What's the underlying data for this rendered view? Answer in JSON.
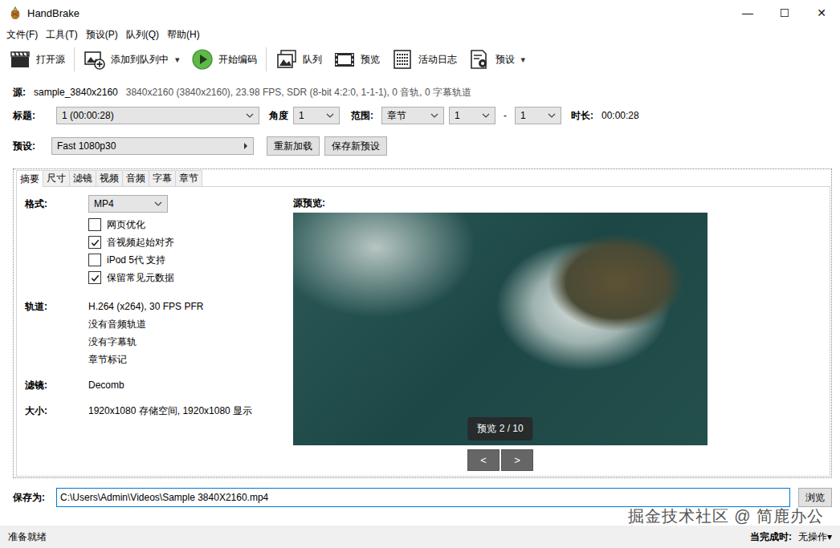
{
  "window": {
    "title": "HandBrake",
    "controls": [
      "—",
      "☐",
      "✕"
    ]
  },
  "menu": [
    "文件(F)",
    "工具(T)",
    "预设(P)",
    "队列(Q)",
    "帮助(H)"
  ],
  "toolbar": [
    {
      "label": "打开源",
      "caret": ""
    },
    {
      "label": "添加到队列中",
      "caret": "▾"
    },
    {
      "label": "开始编码",
      "caret": ""
    },
    {
      "label": "队列",
      "caret": ""
    },
    {
      "label": "预览",
      "caret": ""
    },
    {
      "label": "活动日志",
      "caret": ""
    },
    {
      "label": "预设",
      "caret": "▾"
    }
  ],
  "source": {
    "label": "源:",
    "name": "sample_3840x2160",
    "info": "3840x2160 (3840x2160), 23.98 FPS, SDR (8-bit 4:2:0, 1-1-1), 0 音轨, 0 字幕轨道"
  },
  "title_row": {
    "title_label": "标题:",
    "title_value": "1 (00:00:28)",
    "angle_label": "角度",
    "angle_value": "1",
    "range_label": "范围:",
    "range_type": "章节",
    "range_start": "1",
    "range_sep": "-",
    "range_end": "1",
    "duration_label": "时长:",
    "duration_value": "00:00:28"
  },
  "preset_row": {
    "label": "预设:",
    "value": "Fast 1080p30",
    "buttons": [
      "重新加载",
      "保存新预设"
    ]
  },
  "tabs": [
    {
      "label": "摘要",
      "selected": true
    },
    {
      "label": "尺寸",
      "selected": false
    },
    {
      "label": "滤镜",
      "selected": false
    },
    {
      "label": "视频",
      "selected": false
    },
    {
      "label": "音频",
      "selected": false
    },
    {
      "label": "字幕",
      "selected": false
    },
    {
      "label": "章节",
      "selected": false
    }
  ],
  "summary": {
    "format_label": "格式:",
    "format_value": "MP4",
    "checkboxes": [
      {
        "label": "网页优化",
        "checked": false
      },
      {
        "label": "音视频起始对齐",
        "checked": true
      },
      {
        "label": "iPod 5代 支持",
        "checked": false
      },
      {
        "label": "保留常见元数据",
        "checked": true
      }
    ],
    "sections": [
      {
        "label": "轨道:",
        "lines": [
          "H.264 (x264), 30 FPS PFR",
          "没有音频轨道",
          "没有字幕轨",
          "章节标记"
        ]
      },
      {
        "label": "滤镜:",
        "lines": [
          "Decomb"
        ]
      },
      {
        "label": "大小:",
        "lines": [
          "1920x1080 存储空间, 1920x1080 显示"
        ]
      }
    ]
  },
  "preview": {
    "label": "源预览:",
    "counter": "预览 2 / 10",
    "prev": "<",
    "next": ">"
  },
  "save": {
    "label": "保存为:",
    "path": "C:\\Users\\Admin\\Videos\\Sample 3840X2160.mp4",
    "button": "浏览"
  },
  "status_bar": {
    "text": "准备就绪",
    "when_done_label": "当完成时:",
    "when_done_value": "无操作",
    "caret": "▾"
  },
  "watermark": "掘金技术社区 @ 简鹿办公"
}
